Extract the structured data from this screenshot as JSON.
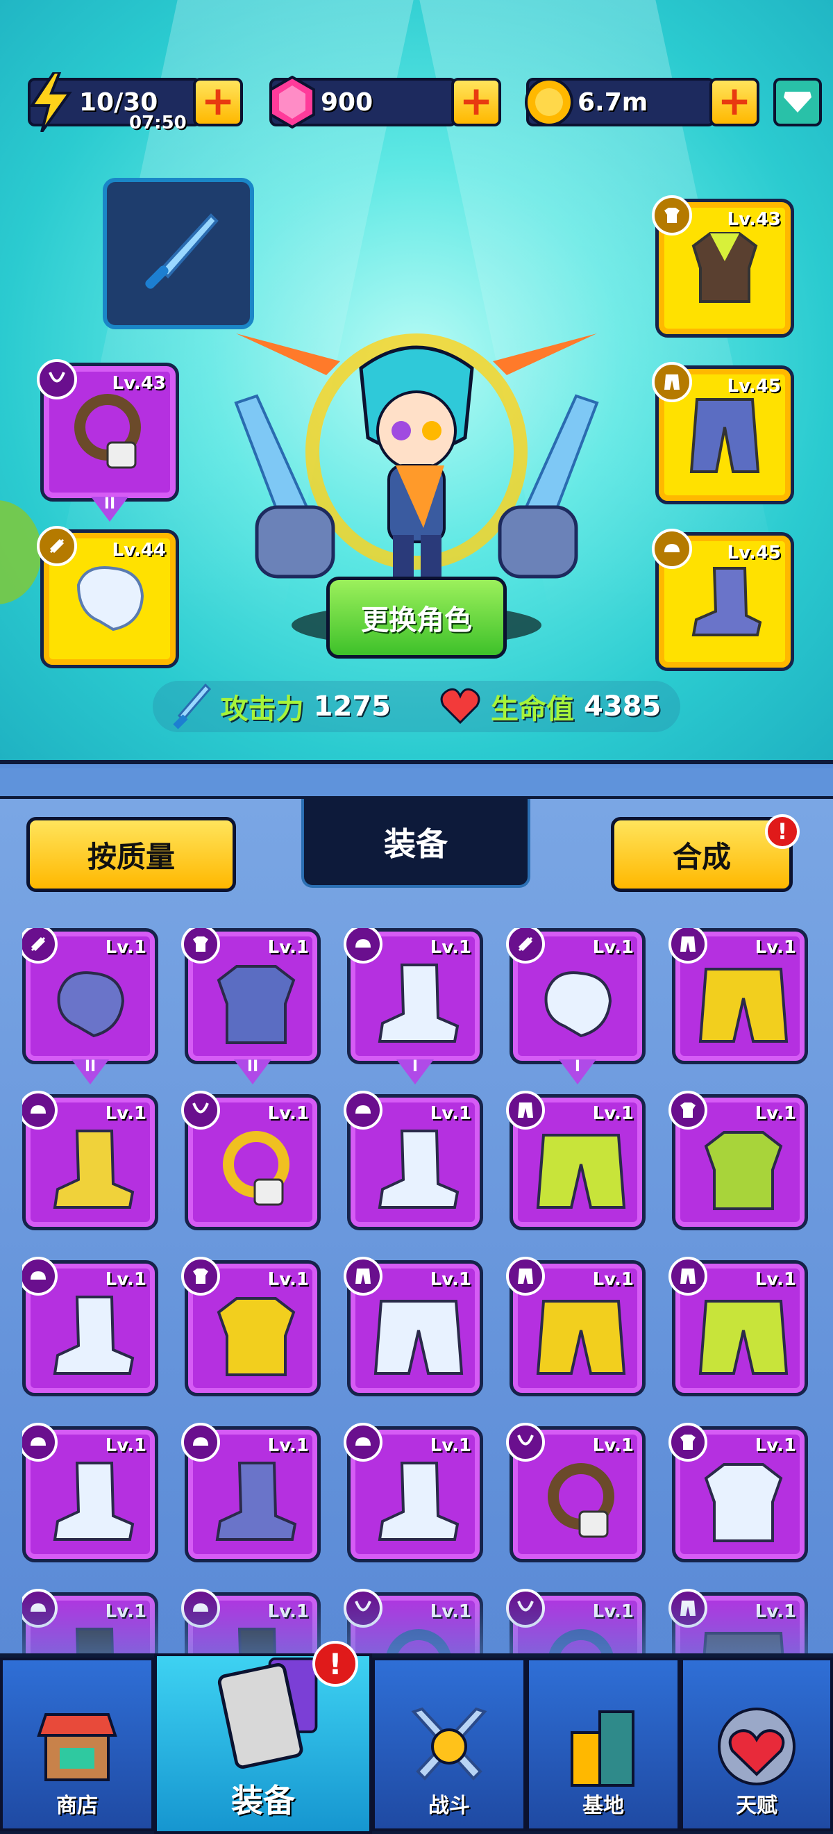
{
  "resources": {
    "energy": {
      "value": "10/30",
      "timer": "07:50",
      "icon": "lightning-icon"
    },
    "gems": {
      "value": "900",
      "icon": "gem-icon"
    },
    "coins": {
      "value": "6.7m",
      "icon": "coin-icon"
    }
  },
  "hero": {
    "change_button": "更换角色",
    "attack_label": "攻击力",
    "attack_value": "1275",
    "hp_label": "生命值",
    "hp_value": "4385",
    "slots": {
      "necklace": {
        "level": "Lv.43",
        "tier": "II"
      },
      "glove": {
        "level": "Lv.44"
      },
      "armor": {
        "level": "Lv.43"
      },
      "pants": {
        "level": "Lv.45"
      },
      "boots": {
        "level": "Lv.45"
      }
    }
  },
  "inventory": {
    "sort_button": "按质量",
    "title": "装备",
    "merge_button": "合成",
    "alert": "!",
    "items": [
      {
        "level": "Lv.1",
        "type": "glove",
        "tier": "II",
        "color": "#6a74c9"
      },
      {
        "level": "Lv.1",
        "type": "armor",
        "tier": "II",
        "color": "#5b6dc2"
      },
      {
        "level": "Lv.1",
        "type": "boots",
        "tier": "I",
        "color": "#e8f2ff"
      },
      {
        "level": "Lv.1",
        "type": "glove",
        "tier": "I",
        "color": "#e8f2ff"
      },
      {
        "level": "Lv.1",
        "type": "pants",
        "tier": "",
        "color": "#f2cf1e"
      },
      {
        "level": "Lv.1",
        "type": "boots",
        "tier": "",
        "color": "#f0d23a"
      },
      {
        "level": "Lv.1",
        "type": "necklace",
        "tier": "",
        "color": "#f0c020"
      },
      {
        "level": "Lv.1",
        "type": "boots",
        "tier": "",
        "color": "#e8f2ff"
      },
      {
        "level": "Lv.1",
        "type": "pants",
        "tier": "",
        "color": "#c8e43a"
      },
      {
        "level": "Lv.1",
        "type": "armor",
        "tier": "",
        "color": "#a8d43a"
      },
      {
        "level": "Lv.1",
        "type": "boots",
        "tier": "",
        "color": "#e8f2ff"
      },
      {
        "level": "Lv.1",
        "type": "armor",
        "tier": "",
        "color": "#f2cf1e"
      },
      {
        "level": "Lv.1",
        "type": "pants",
        "tier": "",
        "color": "#e8f2ff"
      },
      {
        "level": "Lv.1",
        "type": "pants",
        "tier": "",
        "color": "#f2cf1e"
      },
      {
        "level": "Lv.1",
        "type": "pants",
        "tier": "",
        "color": "#c8e43a"
      },
      {
        "level": "Lv.1",
        "type": "boots",
        "tier": "",
        "color": "#e8f2ff"
      },
      {
        "level": "Lv.1",
        "type": "boots",
        "tier": "",
        "color": "#6a74c9"
      },
      {
        "level": "Lv.1",
        "type": "boots",
        "tier": "",
        "color": "#e8f2ff"
      },
      {
        "level": "Lv.1",
        "type": "necklace",
        "tier": "",
        "color": "#6b4a2a"
      },
      {
        "level": "Lv.1",
        "type": "armor",
        "tier": "",
        "color": "#e8f2ff"
      },
      {
        "level": "Lv.1",
        "type": "boots",
        "tier": "",
        "color": "#333"
      },
      {
        "level": "Lv.1",
        "type": "boots",
        "tier": "",
        "color": "#333"
      },
      {
        "level": "Lv.1",
        "type": "necklace",
        "tier": "",
        "color": "#3a5ba0"
      },
      {
        "level": "Lv.1",
        "type": "necklace",
        "tier": "",
        "color": "#3a5ba0"
      },
      {
        "level": "Lv.1",
        "type": "pants",
        "tier": "",
        "color": "#556"
      }
    ]
  },
  "nav": {
    "shop": "商店",
    "equipment": "装备",
    "battle": "战斗",
    "base": "基地",
    "talent": "天赋",
    "alert": "!"
  },
  "colors": {
    "accent_yellow": "#ffb800",
    "epic_purple": "#b530e0",
    "legendary_yellow": "#ffe100",
    "stat_green": "#a7f43a"
  }
}
